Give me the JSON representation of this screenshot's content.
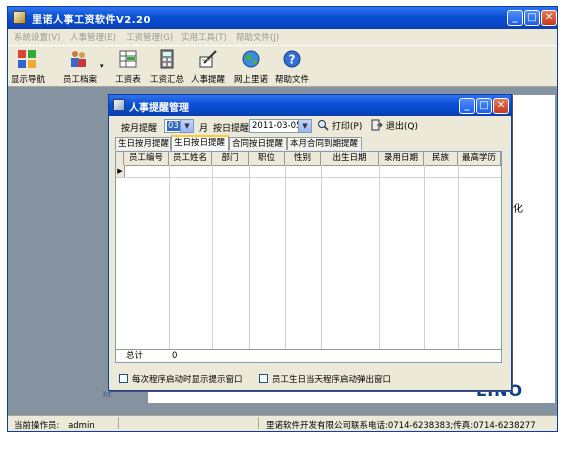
{
  "app": {
    "title": "里诺人事工资软件V2.20",
    "menu": [
      "系统设置(V)",
      "人事管理(E)",
      "工资管理(G)",
      "实用工具(T)",
      "帮助文件(J)"
    ],
    "toolbar": [
      {
        "label": "显示导航",
        "icon": "navigation-grid-icon"
      },
      {
        "label": "员工档案",
        "icon": "people-files-icon"
      },
      {
        "label": "工资表",
        "icon": "spreadsheet-icon"
      },
      {
        "label": "工资汇总",
        "icon": "calculator-icon"
      },
      {
        "label": "人事提醒",
        "icon": "reminder-pen-icon"
      },
      {
        "label": "网上里诺",
        "icon": "globe-icon"
      },
      {
        "label": "帮助文件",
        "icon": "help-icon"
      }
    ],
    "status": {
      "operator_label": "当前操作员:",
      "operator": "admin",
      "company": "里诺软件开发有限公司联系电话:0714-6238383;传真:0714-6238277"
    },
    "background": {
      "side_text": "化",
      "logo": "LINO",
      "url": "ht"
    }
  },
  "dialog": {
    "title": "人事提醒管理",
    "month_label": "按月提醒",
    "month_value": "03",
    "month_unit": "月",
    "day_label": "按日提醒",
    "date_value": "2011-03-05",
    "print_label": "打印(P)",
    "exit_label": "退出(Q)",
    "tabs": [
      "生日按月提醒",
      "生日按日提醒",
      "合同按日提醒",
      "本月合同到期提醒"
    ],
    "active_tab": 1,
    "columns": [
      "员工编号",
      "员工姓名",
      "部门",
      "职位",
      "性别",
      "出生日期",
      "录用日期",
      "民族",
      "最高学历"
    ],
    "total_label": "总计",
    "total_value": "0",
    "checkbox_startup": "每次程序启动时显示提示窗口",
    "checkbox_birthday": "员工生日当天程序启动弹出窗口",
    "accent": "#0a4fd3"
  }
}
